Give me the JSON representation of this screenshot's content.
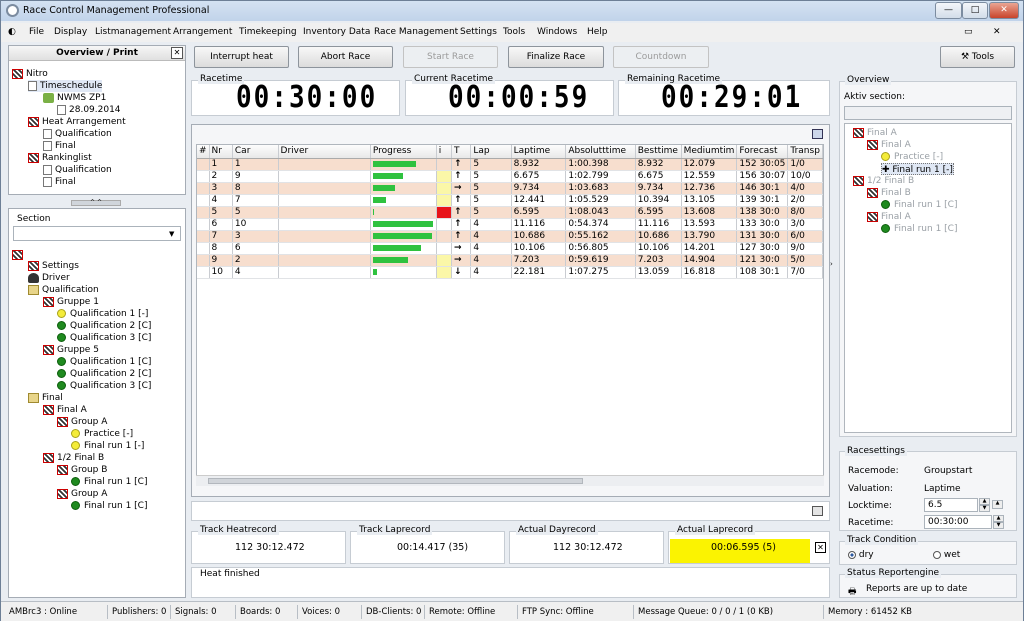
{
  "window": {
    "title": "Race Control Management Professional",
    "min": "—",
    "max": "□",
    "close": "✕",
    "restore": "▭",
    "sub_close": "✕"
  },
  "menu": [
    "File",
    "Display",
    "Listmanagement",
    "Arrangement",
    "Timekeeping",
    "Inventory Data",
    "Race Management",
    "Settings",
    "Tools",
    "Windows",
    "Help"
  ],
  "left_top": {
    "title": "Overview / Print",
    "close": "✕",
    "tree": [
      "Nitro",
      "Timeschedule",
      "NWMS ZP1",
      "28.09.2014",
      "Heat Arrangement",
      "Qualification",
      "Final",
      "Rankinglist",
      "Qualification",
      "Final"
    ]
  },
  "section": {
    "label": "Section",
    "value": ""
  },
  "left_bottom": {
    "tree": [
      "Settings",
      "Driver",
      "Qualification",
      "Gruppe 1",
      "Qualification 1  [-]",
      "Qualification 2  [C]",
      "Qualification 3  [C]",
      "Gruppe 5",
      "Qualification 1  [C]",
      "Qualification 2  [C]",
      "Qualification 3  [C]",
      "Final",
      "Final A",
      "Group A",
      "Practice [-]",
      "Final run 1 [-]",
      "1/2 Final B",
      "Group B",
      "Final run 1  [C]",
      "Group A",
      "Final run 1  [C]"
    ]
  },
  "toolbar": {
    "interrupt": "Interrupt heat",
    "abort": "Abort Race",
    "start": "Start Race",
    "finalize": "Finalize Race",
    "countdown": "Countdown",
    "tools": "Tools"
  },
  "timers": {
    "racetime_label": "Racetime",
    "racetime": "00:30:00",
    "current_label": "Current Racetime",
    "current": "00:00:59",
    "remaining_label": "Remaining Racetime",
    "remaining": "00:29:01"
  },
  "grid": {
    "headers": [
      "#",
      "Nr",
      "Car",
      "Driver",
      "Progress",
      "i",
      "T",
      "Lap",
      "Laptime",
      "Absolutttime",
      "Besttime",
      "Mediumtim",
      "Forecast",
      "Transp"
    ],
    "rows": [
      {
        "n": "1",
        "car": "1",
        "progress": 0.69,
        "i": "",
        "t": "↑",
        "lap": "5",
        "laptime": "8.932",
        "abs": "1:00.398",
        "best": "8.932",
        "med": "12.079",
        "fc": "152 30:05",
        "tr": "1/0"
      },
      {
        "n": "2",
        "car": "9",
        "progress": 0.49,
        "i": "y",
        "t": "↑",
        "lap": "5",
        "laptime": "6.675",
        "abs": "1:02.799",
        "best": "6.675",
        "med": "12.559",
        "fc": "156 30:07",
        "tr": "10/0"
      },
      {
        "n": "3",
        "car": "8",
        "progress": 0.36,
        "i": "y",
        "t": "→",
        "lap": "5",
        "laptime": "9.734",
        "abs": "1:03.683",
        "best": "9.734",
        "med": "12.736",
        "fc": "146 30:1",
        "tr": "4/0"
      },
      {
        "n": "4",
        "car": "7",
        "progress": 0.21,
        "i": "y",
        "t": "↑",
        "lap": "5",
        "laptime": "12.441",
        "abs": "1:05.529",
        "best": "10.394",
        "med": "13.105",
        "fc": "139 30:1",
        "tr": "2/0"
      },
      {
        "n": "5",
        "car": "5",
        "progress": 0.02,
        "i": "r",
        "t": "↑",
        "lap": "5",
        "laptime": "6.595",
        "abs": "1:08.043",
        "best": "6.595",
        "med": "13.608",
        "fc": "138 30:0",
        "tr": "8/0"
      },
      {
        "n": "6",
        "car": "10",
        "progress": 0.97,
        "i": "",
        "t": "↑",
        "lap": "4",
        "laptime": "11.116",
        "abs": "0:54.374",
        "best": "11.116",
        "med": "13.593",
        "fc": "133 30:0",
        "tr": "3/0"
      },
      {
        "n": "7",
        "car": "3",
        "progress": 0.95,
        "i": "",
        "t": "↑",
        "lap": "4",
        "laptime": "10.686",
        "abs": "0:55.162",
        "best": "10.686",
        "med": "13.790",
        "fc": "131 30:0",
        "tr": "6/0"
      },
      {
        "n": "8",
        "car": "6",
        "progress": 0.78,
        "i": "",
        "t": "→",
        "lap": "4",
        "laptime": "10.106",
        "abs": "0:56.805",
        "best": "10.106",
        "med": "14.201",
        "fc": "127 30:0",
        "tr": "9/0"
      },
      {
        "n": "9",
        "car": "2",
        "progress": 0.56,
        "i": "y",
        "t": "→",
        "lap": "4",
        "laptime": "7.203",
        "abs": "0:59.619",
        "best": "7.203",
        "med": "14.904",
        "fc": "121 30:0",
        "tr": "5/0"
      },
      {
        "n": "10",
        "car": "4",
        "progress": 0.07,
        "i": "y",
        "t": "↓",
        "lap": "4",
        "laptime": "22.181",
        "abs": "1:07.275",
        "best": "13.059",
        "med": "16.818",
        "fc": "108 30:1",
        "tr": "7/0"
      }
    ]
  },
  "records": {
    "heat_label": "Track Heatrecord",
    "heat": "112  30:12.472",
    "lap_label": "Track Laprecord",
    "lap": "00:14.417 (35)",
    "day_label": "Actual Dayrecord",
    "day": "112  30:12.472",
    "actlap_label": "Actual Laprecord",
    "actlap": "00:06.595 (5)",
    "close": "✕"
  },
  "message": "Heat finished",
  "overview": {
    "title": "Overview",
    "aktiv_label": "Aktiv section:",
    "aktiv_value": "",
    "tree": [
      "Final A",
      "Final A",
      "Practice  [-]",
      "Final run 1  [-]",
      "1/2 Final B",
      "Final B",
      "Final run 1  [C]",
      "Final A",
      "Final run 1  [C]"
    ]
  },
  "racesettings": {
    "title": "Racesettings",
    "mode_label": "Racemode:",
    "mode": "Groupstart",
    "val_label": "Valuation:",
    "val": "Laptime",
    "lock_label": "Locktime:",
    "lock": "6.5",
    "rt_label": "Racetime:",
    "rt": "00:30:00"
  },
  "track": {
    "title": "Track Condition",
    "dry": "dry",
    "wet": "wet"
  },
  "report": {
    "title": "Status Reportengine",
    "text": "Reports are up to date"
  },
  "status": [
    "AMBrc3 : Online",
    "Publishers: 0",
    "Signals: 0",
    "Boards: 0",
    "Voices: 0",
    "DB-Clients: 0",
    "Remote: Offline",
    "FTP Sync: Offline",
    "Message Queue: 0 / 0 / 1 (0 KB)",
    "Memory : 61452 KB"
  ]
}
